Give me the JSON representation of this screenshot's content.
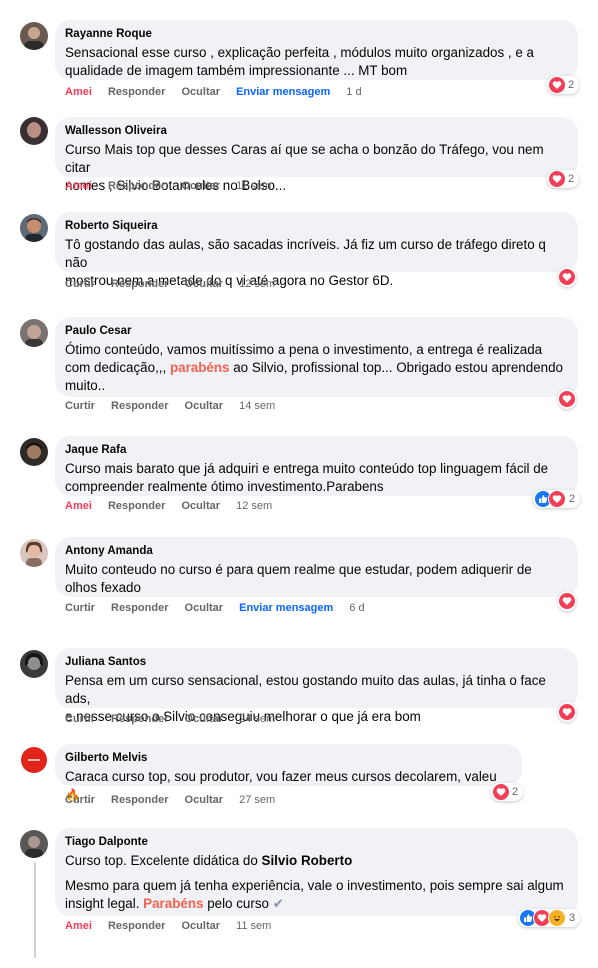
{
  "comments": [
    {
      "author": "Rayanne Roque",
      "lines": [
        "Sensacional esse curso , explicação perfeita , módulos muito organizados , e a",
        "qualidade de imagem também impressionante ... MT bom"
      ],
      "actions": {
        "react": "Amei",
        "reply": "Responder",
        "hide": "Ocultar",
        "message": "Enviar mensagem",
        "time": "1 d"
      },
      "reactions": {
        "count": "2"
      }
    },
    {
      "author": "Wallesson Oliveira",
      "lines": [
        "Curso Mais top que desses Caras aí que se acha o bonzão do Tráfego, vou nem citar",
        "nomes , Silvio Botam eles no Bolso..."
      ],
      "actions": {
        "react": "Amei",
        "reply": "Responder",
        "hide": "Ocultar",
        "time": "11 sem"
      },
      "reactions": {
        "count": "2"
      }
    },
    {
      "author": "Roberto Siqueira",
      "lines": [
        "Tô gostando das aulas, são sacadas incríveis. Já fiz um curso de tráfego direto q não",
        "mostrou nem a metade do q vi até agora no Gestor 6D."
      ],
      "actions": {
        "react": "Curtir",
        "reply": "Responder",
        "hide": "Ocultar",
        "time": "12 sem"
      },
      "reactions": {
        "count": ""
      }
    },
    {
      "author": "Paulo Cesar",
      "line1": "Ótimo conteúdo, vamos muitíssimo a pena o investimento, a entrega é realizada",
      "line2_pre": "com dedicação,,, ",
      "line2_hl": "parabéns",
      "line2_post": " ao Silvio, profissional top... Obrigado estou aprendendo",
      "line3": "muito..",
      "actions": {
        "react": "Curtir",
        "reply": "Responder",
        "hide": "Ocultar",
        "time": "14 sem"
      },
      "reactions": {
        "count": ""
      }
    },
    {
      "author": "Jaque Rafa",
      "lines": [
        "Curso mais barato que já adquiri e entrega muito conteúdo top linguagem fácil de",
        "compreender realmente ótimo investimento.Parabens"
      ],
      "actions": {
        "react": "Amei",
        "reply": "Responder",
        "hide": "Ocultar",
        "time": "12 sem"
      },
      "reactions": {
        "count": "2"
      }
    },
    {
      "author": "Antony Amanda",
      "lines": [
        "Muito conteudo no curso é para quem realme que estudar, podem adiquerir de",
        "olhos fexado"
      ],
      "actions": {
        "react": "Curtir",
        "reply": "Responder",
        "hide": "Ocultar",
        "message": "Enviar mensagem",
        "time": "6 d"
      },
      "reactions": {
        "count": ""
      }
    },
    {
      "author": "Juliana Santos",
      "lines": [
        "Pensa em um curso sensacional, estou gostando muito das aulas, já tinha o face ads,",
        "e nesse curso o Silvio conseguiu melhorar o que já era bom"
      ],
      "actions": {
        "react": "Curtir",
        "reply": "Responder",
        "hide": "Ocultar",
        "time": "24 sem"
      },
      "reactions": {
        "count": ""
      }
    },
    {
      "author": "Gilberto Melvis",
      "text": "Caraca curso top, sou produtor, vou fazer meus cursos decolarem, valeu",
      "emoji": "🔥",
      "actions": {
        "react": "Curtir",
        "reply": "Responder",
        "hide": "Ocultar",
        "time": "27 sem"
      },
      "reactions": {
        "count": "2"
      }
    },
    {
      "author": "Tiago Dalponte",
      "line1_pre": "Curso top. Excelente didática do ",
      "line1_bold": "Silvio Roberto",
      "line2": "Mesmo para quem já tenha experiência, vale o investimento, pois sempre sai algum",
      "line3_pre": "insight legal. ",
      "line3_hl": "Parabéns",
      "line3_post": " pelo curso",
      "emoji": "✔",
      "actions": {
        "react": "Amei",
        "reply": "Responder",
        "hide": "Ocultar",
        "time": "11 sem"
      },
      "reactions": {
        "count": "3"
      }
    }
  ],
  "colors": {
    "bubble": "#f0f2f5",
    "love": "#f33e58",
    "like": "#1877f2",
    "link": "#0866ff",
    "highlight": "#f7624f"
  }
}
